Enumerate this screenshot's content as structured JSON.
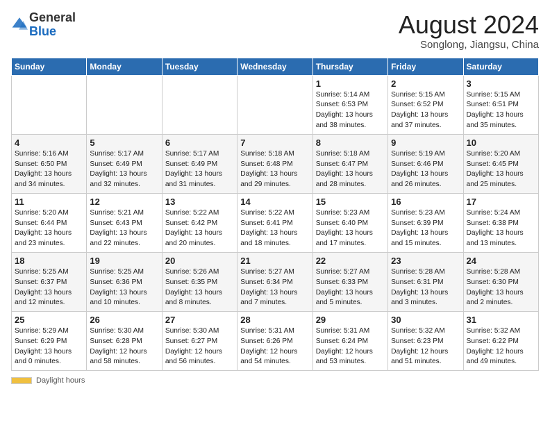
{
  "header": {
    "logo_general": "General",
    "logo_blue": "Blue",
    "title": "August 2024",
    "subtitle": "Songlong, Jiangsu, China"
  },
  "weekdays": [
    "Sunday",
    "Monday",
    "Tuesday",
    "Wednesday",
    "Thursday",
    "Friday",
    "Saturday"
  ],
  "weeks": [
    [
      {
        "day": "",
        "info": ""
      },
      {
        "day": "",
        "info": ""
      },
      {
        "day": "",
        "info": ""
      },
      {
        "day": "",
        "info": ""
      },
      {
        "day": "1",
        "info": "Sunrise: 5:14 AM\nSunset: 6:53 PM\nDaylight: 13 hours\nand 38 minutes."
      },
      {
        "day": "2",
        "info": "Sunrise: 5:15 AM\nSunset: 6:52 PM\nDaylight: 13 hours\nand 37 minutes."
      },
      {
        "day": "3",
        "info": "Sunrise: 5:15 AM\nSunset: 6:51 PM\nDaylight: 13 hours\nand 35 minutes."
      }
    ],
    [
      {
        "day": "4",
        "info": "Sunrise: 5:16 AM\nSunset: 6:50 PM\nDaylight: 13 hours\nand 34 minutes."
      },
      {
        "day": "5",
        "info": "Sunrise: 5:17 AM\nSunset: 6:49 PM\nDaylight: 13 hours\nand 32 minutes."
      },
      {
        "day": "6",
        "info": "Sunrise: 5:17 AM\nSunset: 6:49 PM\nDaylight: 13 hours\nand 31 minutes."
      },
      {
        "day": "7",
        "info": "Sunrise: 5:18 AM\nSunset: 6:48 PM\nDaylight: 13 hours\nand 29 minutes."
      },
      {
        "day": "8",
        "info": "Sunrise: 5:18 AM\nSunset: 6:47 PM\nDaylight: 13 hours\nand 28 minutes."
      },
      {
        "day": "9",
        "info": "Sunrise: 5:19 AM\nSunset: 6:46 PM\nDaylight: 13 hours\nand 26 minutes."
      },
      {
        "day": "10",
        "info": "Sunrise: 5:20 AM\nSunset: 6:45 PM\nDaylight: 13 hours\nand 25 minutes."
      }
    ],
    [
      {
        "day": "11",
        "info": "Sunrise: 5:20 AM\nSunset: 6:44 PM\nDaylight: 13 hours\nand 23 minutes."
      },
      {
        "day": "12",
        "info": "Sunrise: 5:21 AM\nSunset: 6:43 PM\nDaylight: 13 hours\nand 22 minutes."
      },
      {
        "day": "13",
        "info": "Sunrise: 5:22 AM\nSunset: 6:42 PM\nDaylight: 13 hours\nand 20 minutes."
      },
      {
        "day": "14",
        "info": "Sunrise: 5:22 AM\nSunset: 6:41 PM\nDaylight: 13 hours\nand 18 minutes."
      },
      {
        "day": "15",
        "info": "Sunrise: 5:23 AM\nSunset: 6:40 PM\nDaylight: 13 hours\nand 17 minutes."
      },
      {
        "day": "16",
        "info": "Sunrise: 5:23 AM\nSunset: 6:39 PM\nDaylight: 13 hours\nand 15 minutes."
      },
      {
        "day": "17",
        "info": "Sunrise: 5:24 AM\nSunset: 6:38 PM\nDaylight: 13 hours\nand 13 minutes."
      }
    ],
    [
      {
        "day": "18",
        "info": "Sunrise: 5:25 AM\nSunset: 6:37 PM\nDaylight: 13 hours\nand 12 minutes."
      },
      {
        "day": "19",
        "info": "Sunrise: 5:25 AM\nSunset: 6:36 PM\nDaylight: 13 hours\nand 10 minutes."
      },
      {
        "day": "20",
        "info": "Sunrise: 5:26 AM\nSunset: 6:35 PM\nDaylight: 13 hours\nand 8 minutes."
      },
      {
        "day": "21",
        "info": "Sunrise: 5:27 AM\nSunset: 6:34 PM\nDaylight: 13 hours\nand 7 minutes."
      },
      {
        "day": "22",
        "info": "Sunrise: 5:27 AM\nSunset: 6:33 PM\nDaylight: 13 hours\nand 5 minutes."
      },
      {
        "day": "23",
        "info": "Sunrise: 5:28 AM\nSunset: 6:31 PM\nDaylight: 13 hours\nand 3 minutes."
      },
      {
        "day": "24",
        "info": "Sunrise: 5:28 AM\nSunset: 6:30 PM\nDaylight: 13 hours\nand 2 minutes."
      }
    ],
    [
      {
        "day": "25",
        "info": "Sunrise: 5:29 AM\nSunset: 6:29 PM\nDaylight: 13 hours\nand 0 minutes."
      },
      {
        "day": "26",
        "info": "Sunrise: 5:30 AM\nSunset: 6:28 PM\nDaylight: 12 hours\nand 58 minutes."
      },
      {
        "day": "27",
        "info": "Sunrise: 5:30 AM\nSunset: 6:27 PM\nDaylight: 12 hours\nand 56 minutes."
      },
      {
        "day": "28",
        "info": "Sunrise: 5:31 AM\nSunset: 6:26 PM\nDaylight: 12 hours\nand 54 minutes."
      },
      {
        "day": "29",
        "info": "Sunrise: 5:31 AM\nSunset: 6:24 PM\nDaylight: 12 hours\nand 53 minutes."
      },
      {
        "day": "30",
        "info": "Sunrise: 5:32 AM\nSunset: 6:23 PM\nDaylight: 12 hours\nand 51 minutes."
      },
      {
        "day": "31",
        "info": "Sunrise: 5:32 AM\nSunset: 6:22 PM\nDaylight: 12 hours\nand 49 minutes."
      }
    ]
  ],
  "footer": {
    "daylight_label": "Daylight hours"
  }
}
